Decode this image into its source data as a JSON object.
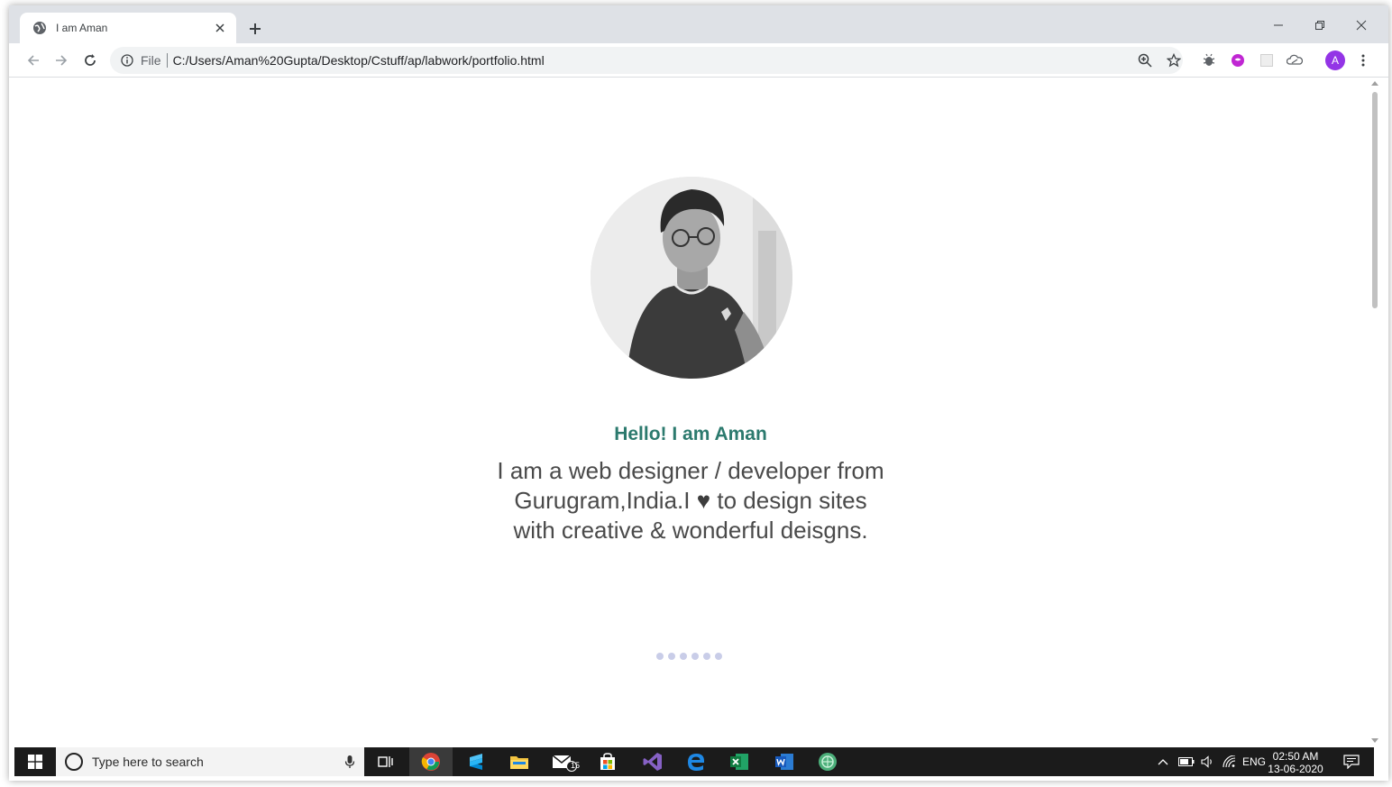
{
  "browser": {
    "tab_title": "I am Aman",
    "url_scheme": "File",
    "url": "C:/Users/Aman%20Gupta/Desktop/Cstuff/ap/labwork/portfolio.html",
    "profile_initial": "A",
    "profile_color": "#9334e6"
  },
  "page": {
    "greeting": "Hello! I am Aman",
    "intro_part1": "I am a web designer / developer from Gurugram,India.I",
    "heart_glyph": "♥",
    "intro_part2": "to design sites with creative & wonderful deisgns.",
    "accent_color": "#2c7a6e",
    "loader_dots": 6
  },
  "taskbar": {
    "search_placeholder": "Type here to search",
    "mail_badge": "15",
    "language": "ENG",
    "time": "02:50 AM",
    "date": "13-06-2020"
  },
  "icons": [
    "globe-icon",
    "close-icon",
    "plus-icon",
    "minimize-icon",
    "restore-icon",
    "back-arrow-icon",
    "forward-arrow-icon",
    "reload-icon",
    "info-icon",
    "zoom-icon",
    "star-icon",
    "bug-extension-icon",
    "chat-extension-icon",
    "extension-icon",
    "cloud-extension-icon",
    "more-vert-icon",
    "windows-start-icon",
    "cortana-icon",
    "mic-icon",
    "task-view-icon",
    "chrome-icon",
    "sublime-icon",
    "file-explorer-icon",
    "mail-icon",
    "store-icon",
    "visual-studio-icon",
    "edge-icon",
    "excel-icon",
    "word-icon",
    "globe-app-icon"
  ]
}
